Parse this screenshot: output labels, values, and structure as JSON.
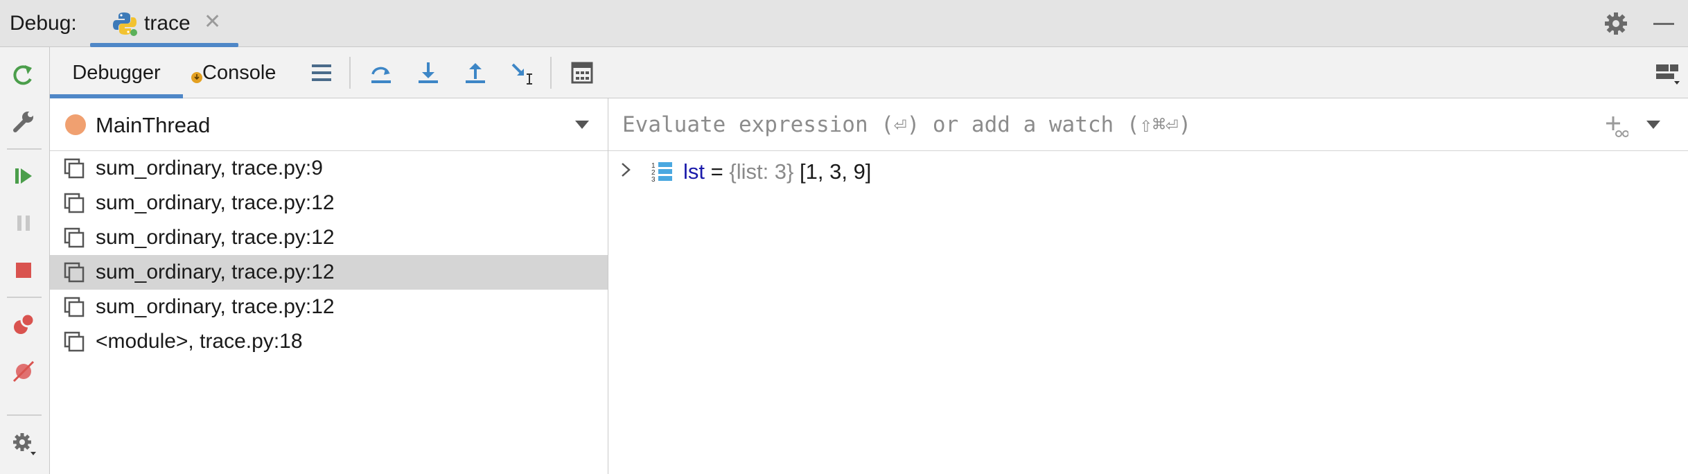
{
  "window": {
    "title_label": "Debug:",
    "tab": {
      "name": "trace",
      "close_glyph": "✕",
      "icon": "python-icon"
    }
  },
  "left_toolbar": {
    "items": [
      {
        "name": "rerun-icon"
      },
      {
        "name": "wrench-icon"
      },
      {
        "name": "resume-icon"
      },
      {
        "name": "pause-icon"
      },
      {
        "name": "stop-icon"
      },
      {
        "name": "view-breakpoints-icon"
      },
      {
        "name": "mute-breakpoints-icon"
      },
      {
        "name": "settings-icon"
      }
    ]
  },
  "toolbar": {
    "tabs": [
      {
        "label": "Debugger",
        "active": true
      },
      {
        "label": "Console",
        "active": false
      }
    ],
    "actions": [
      {
        "name": "show-execution-point-icon"
      },
      {
        "name": "step-over-icon"
      },
      {
        "name": "step-into-icon"
      },
      {
        "name": "step-out-icon"
      },
      {
        "name": "run-to-cursor-icon"
      },
      {
        "name": "evaluate-expression-icon"
      }
    ]
  },
  "frames": {
    "thread": "MainThread",
    "items": [
      {
        "label": "sum_ordinary, trace.py:9",
        "selected": false
      },
      {
        "label": "sum_ordinary, trace.py:12",
        "selected": false
      },
      {
        "label": "sum_ordinary, trace.py:12",
        "selected": false
      },
      {
        "label": "sum_ordinary, trace.py:12",
        "selected": true
      },
      {
        "label": "sum_ordinary, trace.py:12",
        "selected": false
      },
      {
        "label": "<module>, trace.py:18",
        "selected": false
      }
    ]
  },
  "variables": {
    "eval_placeholder": "Evaluate expression (⏎) or add a watch (⇧⌘⏎)",
    "items": [
      {
        "name": "lst",
        "eq": " = ",
        "type": "{list: 3}",
        "value": " [1, 3, 9]"
      }
    ]
  },
  "colors": {
    "accent": "#4f87c7",
    "selection": "#d5d5d5",
    "thread_dot": "#f0a070",
    "var_name": "#1a1aaa"
  }
}
